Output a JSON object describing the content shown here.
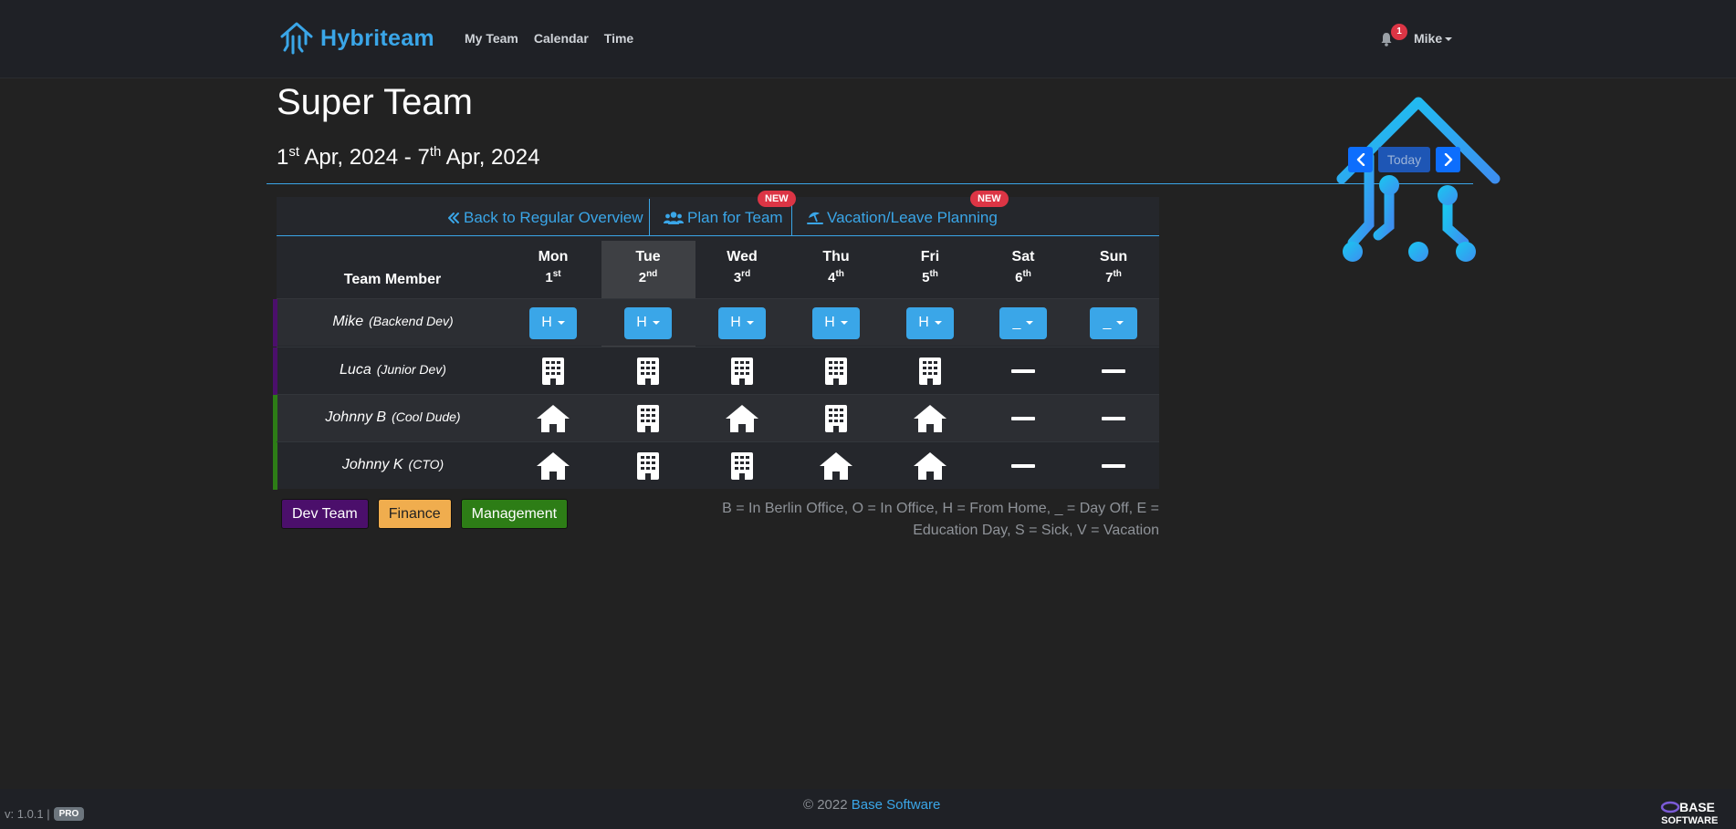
{
  "app": {
    "name": "Hybriteam"
  },
  "nav": {
    "links": [
      "My Team",
      "Calendar",
      "Time"
    ]
  },
  "user": {
    "name": "Mike",
    "notifications": "1"
  },
  "page": {
    "title": "Super Team"
  },
  "date_range": {
    "start_day": "1",
    "start_suffix": "st",
    "start_rest": " Apr, 2024 - 7",
    "end_suffix": "th",
    "end_rest": " Apr, 2024"
  },
  "week_nav": {
    "today": "Today"
  },
  "tabs": {
    "back": "Back to Regular Overview",
    "plan": "Plan for Team",
    "vacation": "Vacation/Leave Planning",
    "new_badge": "NEW"
  },
  "table": {
    "member_header": "Team Member",
    "days": [
      {
        "name": "Mon",
        "num": "1",
        "suffix": "st"
      },
      {
        "name": "Tue",
        "num": "2",
        "suffix": "nd"
      },
      {
        "name": "Wed",
        "num": "3",
        "suffix": "rd"
      },
      {
        "name": "Thu",
        "num": "4",
        "suffix": "th"
      },
      {
        "name": "Fri",
        "num": "5",
        "suffix": "th"
      },
      {
        "name": "Sat",
        "num": "6",
        "suffix": "th"
      },
      {
        "name": "Sun",
        "num": "7",
        "suffix": "th"
      }
    ],
    "rows": [
      {
        "name": "Mike",
        "role": "(Backend Dev)",
        "group_color": "#4b0f6b",
        "cells": [
          "H",
          "H",
          "H",
          "H",
          "H",
          "_",
          "_"
        ]
      },
      {
        "name": "Luca",
        "role": "(Junior Dev)",
        "group_color": "#4b0f6b",
        "cells": [
          "office",
          "office",
          "office",
          "office",
          "office",
          "off",
          "off"
        ]
      },
      {
        "name": "Johnny B",
        "role": "(Cool Dude)",
        "group_color": "#2d7d16",
        "cells": [
          "home",
          "office",
          "home",
          "office",
          "home",
          "off",
          "off"
        ]
      },
      {
        "name": "Johnny K",
        "role": "(CTO)",
        "group_color": "#2d7d16",
        "cells": [
          "home",
          "office",
          "office",
          "home",
          "home",
          "off",
          "off"
        ]
      }
    ]
  },
  "groups": [
    {
      "label": "Dev Team",
      "bg": "#4b0f6b",
      "fg": "#ffffff"
    },
    {
      "label": "Finance",
      "bg": "#f0ad4e",
      "fg": "#222222"
    },
    {
      "label": "Management",
      "bg": "#2d7d16",
      "fg": "#ffffff"
    }
  ],
  "legend_text": "B = In Berlin Office, O = In Office, H = From Home, _ = Day Off, E = Education Day, S = Sick, V = Vacation",
  "footer": {
    "copyright": "© 2022",
    "company": "Base Software",
    "version": "v: 1.0.1 |",
    "pro": "PRO",
    "logo_top": "BASE",
    "logo_bottom": "SOFTWARE"
  },
  "colors": {
    "accent": "#3aa6e8",
    "badge": "#dc3545",
    "nav_btn": "#0d6efd"
  }
}
